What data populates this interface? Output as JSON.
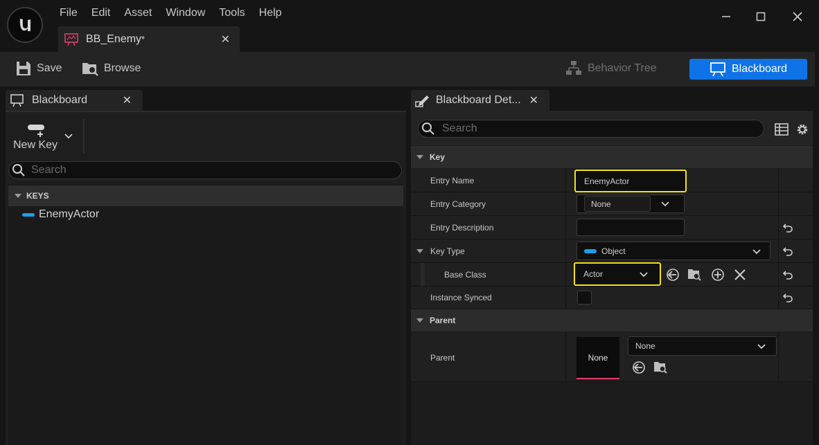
{
  "menu": [
    "File",
    "Edit",
    "Asset",
    "Window",
    "Tools",
    "Help"
  ],
  "document_tab": {
    "name": "BB_Enemy",
    "modified_mark": "*",
    "close": "✕"
  },
  "toolbar": {
    "save": "Save",
    "browse": "Browse",
    "behavior_tree": "Behavior Tree",
    "blackboard": "Blackboard"
  },
  "left_panel": {
    "tab": "Blackboard",
    "new_key": "New Key",
    "search_placeholder": "Search",
    "section": "KEYS",
    "keys": [
      {
        "name": "EnemyActor",
        "color": "#1aa0e8"
      }
    ]
  },
  "right_panel": {
    "tab": "Blackboard Det...",
    "search_placeholder": "Search",
    "sections": {
      "key": "Key",
      "parent": "Parent"
    },
    "rows": {
      "entry_name": {
        "label": "Entry Name",
        "value": "EnemyActor"
      },
      "entry_category": {
        "label": "Entry Category",
        "value": "None"
      },
      "entry_description": {
        "label": "Entry Description",
        "value": ""
      },
      "key_type": {
        "label": "Key Type",
        "value": "Object"
      },
      "base_class": {
        "label": "Base Class",
        "value": "Actor"
      },
      "instance_synced": {
        "label": "Instance Synced",
        "checked": false
      },
      "parent": {
        "label": "Parent",
        "thumbnail": "None",
        "value": "None"
      }
    }
  },
  "colors": {
    "accent": "#0f73e8",
    "highlight": "#f2e21a",
    "object_pill": "#1aa0e8"
  }
}
